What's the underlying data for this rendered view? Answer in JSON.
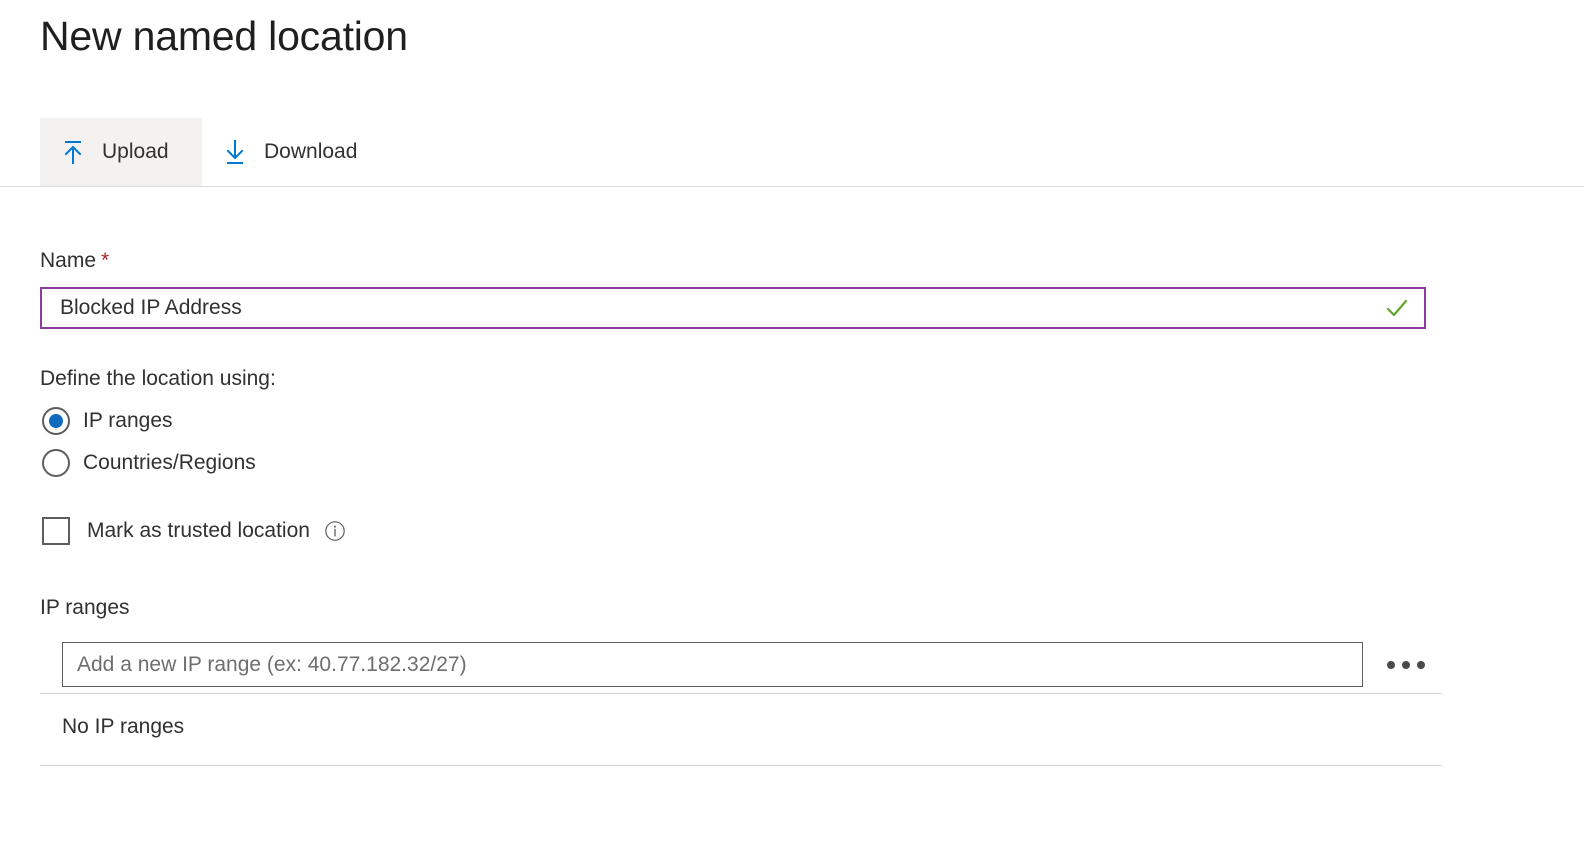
{
  "page": {
    "title": "New named location"
  },
  "toolbar": {
    "buttons": [
      {
        "label": "Upload",
        "icon": "upload-icon",
        "active": true
      },
      {
        "label": "Download",
        "icon": "download-icon",
        "active": false
      }
    ]
  },
  "form": {
    "name_field": {
      "label": "Name",
      "required_marker": "*",
      "value": "Blocked IP Address",
      "placeholder": "",
      "valid": true,
      "focus_border_color": "#8c3d9b",
      "check_color": "#5fa52a"
    },
    "define_using": {
      "label": "Define the location using:",
      "options": [
        {
          "label": "IP ranges",
          "selected": true
        },
        {
          "label": "Countries/Regions",
          "selected": false
        }
      ],
      "selected_color": "#0f6cbd"
    },
    "trusted": {
      "label": "Mark as trusted location",
      "checked": false,
      "info_icon": "info-circle-icon"
    },
    "ip_ranges": {
      "label": "IP ranges",
      "input_placeholder": "Add a new IP range (ex: 40.77.182.32/27)",
      "input_value": "",
      "more_menu_icon": "ellipsis-icon",
      "empty_message": "No IP ranges"
    }
  },
  "colors": {
    "accent_blue": "#0078d4",
    "command_active_bg": "#f3f2f1",
    "divider": "#d2d0ce",
    "text": "#323130"
  }
}
